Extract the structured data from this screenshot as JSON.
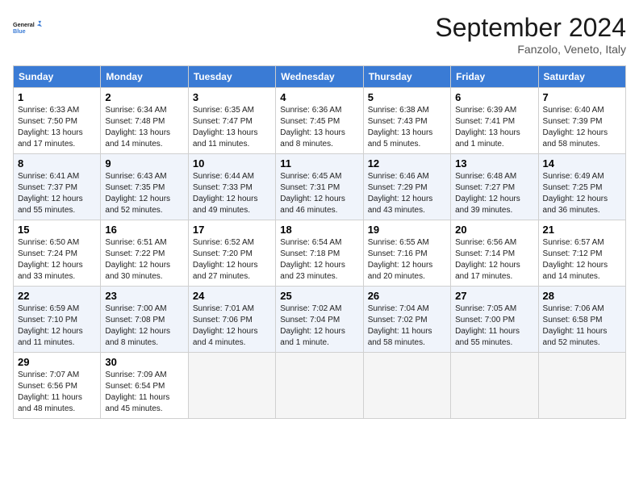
{
  "header": {
    "logo_line1": "General",
    "logo_line2": "Blue",
    "month": "September 2024",
    "location": "Fanzolo, Veneto, Italy"
  },
  "columns": [
    "Sunday",
    "Monday",
    "Tuesday",
    "Wednesday",
    "Thursday",
    "Friday",
    "Saturday"
  ],
  "weeks": [
    [
      {
        "day": 1,
        "sunrise": "6:33 AM",
        "sunset": "7:50 PM",
        "daylight": "13 hours and 17 minutes."
      },
      {
        "day": 2,
        "sunrise": "6:34 AM",
        "sunset": "7:48 PM",
        "daylight": "13 hours and 14 minutes."
      },
      {
        "day": 3,
        "sunrise": "6:35 AM",
        "sunset": "7:47 PM",
        "daylight": "13 hours and 11 minutes."
      },
      {
        "day": 4,
        "sunrise": "6:36 AM",
        "sunset": "7:45 PM",
        "daylight": "13 hours and 8 minutes."
      },
      {
        "day": 5,
        "sunrise": "6:38 AM",
        "sunset": "7:43 PM",
        "daylight": "13 hours and 5 minutes."
      },
      {
        "day": 6,
        "sunrise": "6:39 AM",
        "sunset": "7:41 PM",
        "daylight": "13 hours and 1 minute."
      },
      {
        "day": 7,
        "sunrise": "6:40 AM",
        "sunset": "7:39 PM",
        "daylight": "12 hours and 58 minutes."
      }
    ],
    [
      {
        "day": 8,
        "sunrise": "6:41 AM",
        "sunset": "7:37 PM",
        "daylight": "12 hours and 55 minutes."
      },
      {
        "day": 9,
        "sunrise": "6:43 AM",
        "sunset": "7:35 PM",
        "daylight": "12 hours and 52 minutes."
      },
      {
        "day": 10,
        "sunrise": "6:44 AM",
        "sunset": "7:33 PM",
        "daylight": "12 hours and 49 minutes."
      },
      {
        "day": 11,
        "sunrise": "6:45 AM",
        "sunset": "7:31 PM",
        "daylight": "12 hours and 46 minutes."
      },
      {
        "day": 12,
        "sunrise": "6:46 AM",
        "sunset": "7:29 PM",
        "daylight": "12 hours and 43 minutes."
      },
      {
        "day": 13,
        "sunrise": "6:48 AM",
        "sunset": "7:27 PM",
        "daylight": "12 hours and 39 minutes."
      },
      {
        "day": 14,
        "sunrise": "6:49 AM",
        "sunset": "7:25 PM",
        "daylight": "12 hours and 36 minutes."
      }
    ],
    [
      {
        "day": 15,
        "sunrise": "6:50 AM",
        "sunset": "7:24 PM",
        "daylight": "12 hours and 33 minutes."
      },
      {
        "day": 16,
        "sunrise": "6:51 AM",
        "sunset": "7:22 PM",
        "daylight": "12 hours and 30 minutes."
      },
      {
        "day": 17,
        "sunrise": "6:52 AM",
        "sunset": "7:20 PM",
        "daylight": "12 hours and 27 minutes."
      },
      {
        "day": 18,
        "sunrise": "6:54 AM",
        "sunset": "7:18 PM",
        "daylight": "12 hours and 23 minutes."
      },
      {
        "day": 19,
        "sunrise": "6:55 AM",
        "sunset": "7:16 PM",
        "daylight": "12 hours and 20 minutes."
      },
      {
        "day": 20,
        "sunrise": "6:56 AM",
        "sunset": "7:14 PM",
        "daylight": "12 hours and 17 minutes."
      },
      {
        "day": 21,
        "sunrise": "6:57 AM",
        "sunset": "7:12 PM",
        "daylight": "12 hours and 14 minutes."
      }
    ],
    [
      {
        "day": 22,
        "sunrise": "6:59 AM",
        "sunset": "7:10 PM",
        "daylight": "12 hours and 11 minutes."
      },
      {
        "day": 23,
        "sunrise": "7:00 AM",
        "sunset": "7:08 PM",
        "daylight": "12 hours and 8 minutes."
      },
      {
        "day": 24,
        "sunrise": "7:01 AM",
        "sunset": "7:06 PM",
        "daylight": "12 hours and 4 minutes."
      },
      {
        "day": 25,
        "sunrise": "7:02 AM",
        "sunset": "7:04 PM",
        "daylight": "12 hours and 1 minute."
      },
      {
        "day": 26,
        "sunrise": "7:04 AM",
        "sunset": "7:02 PM",
        "daylight": "11 hours and 58 minutes."
      },
      {
        "day": 27,
        "sunrise": "7:05 AM",
        "sunset": "7:00 PM",
        "daylight": "11 hours and 55 minutes."
      },
      {
        "day": 28,
        "sunrise": "7:06 AM",
        "sunset": "6:58 PM",
        "daylight": "11 hours and 52 minutes."
      }
    ],
    [
      {
        "day": 29,
        "sunrise": "7:07 AM",
        "sunset": "6:56 PM",
        "daylight": "11 hours and 48 minutes."
      },
      {
        "day": 30,
        "sunrise": "7:09 AM",
        "sunset": "6:54 PM",
        "daylight": "11 hours and 45 minutes."
      },
      null,
      null,
      null,
      null,
      null
    ]
  ]
}
